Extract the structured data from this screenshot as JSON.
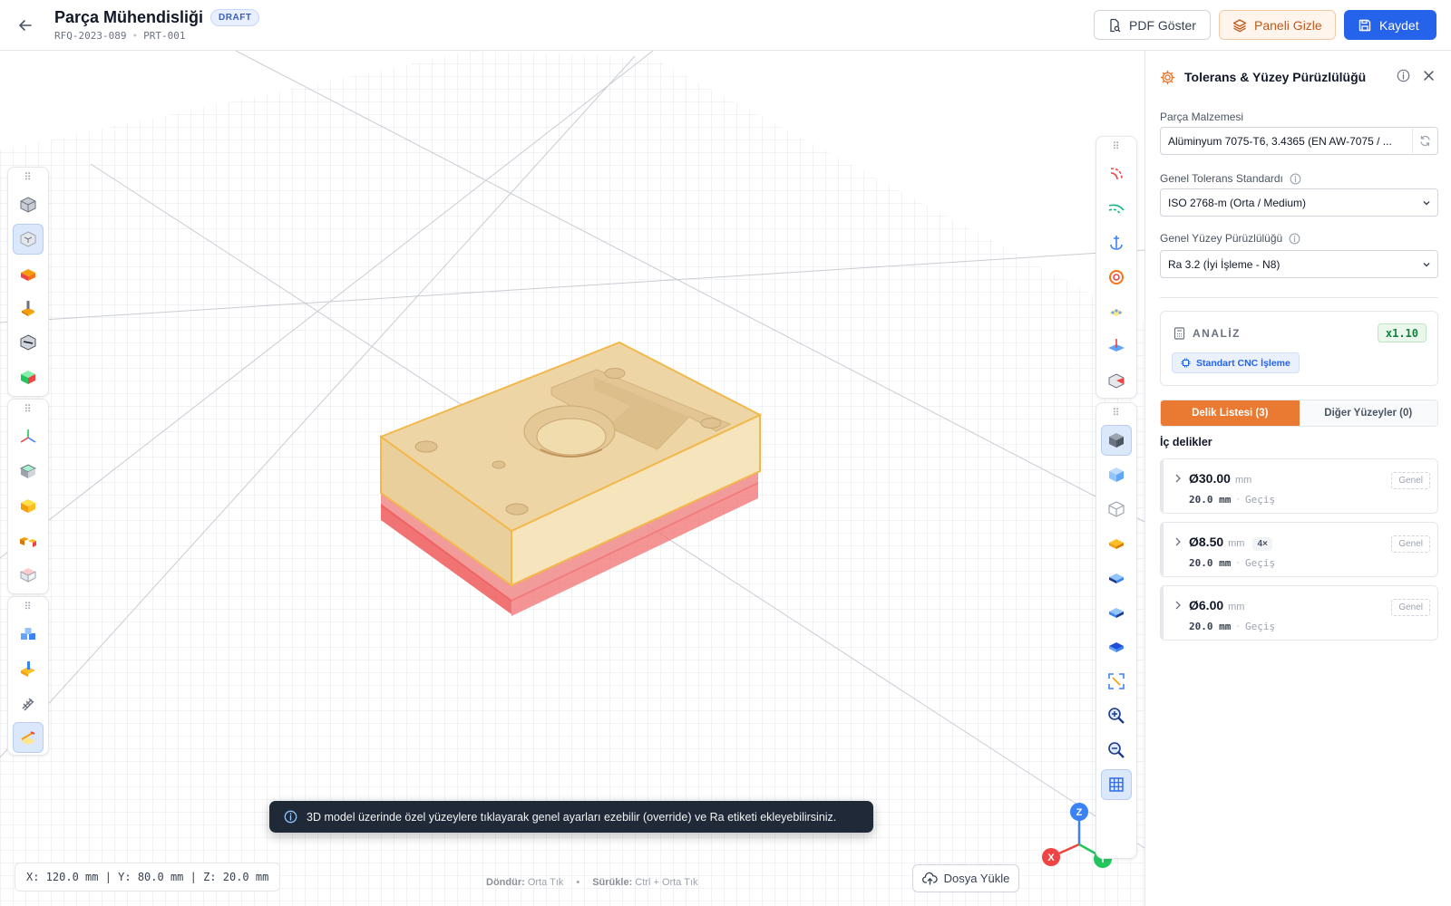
{
  "header": {
    "title": "Parça Mühendisliği",
    "badge": "DRAFT",
    "rfq": "RFQ-2023-089",
    "separator": "•",
    "part_no": "PRT-001",
    "pdf_label": "PDF Göster",
    "panel_label": "Paneli Gizle",
    "save_label": "Kaydet"
  },
  "viewport": {
    "coords": "X: 120.0 mm | Y: 80.0 mm | Z: 20.0 mm",
    "hint_rotate_key": "Döndür:",
    "hint_rotate_val": "Orta Tık",
    "hint_separator": "•",
    "hint_pan_key": "Sürükle:",
    "hint_pan_val": "Ctrl + Orta Tık",
    "upload_label": "Dosya Yükle",
    "toast": "3D model üzerinde özel yüzeylere tıklayarak genel ayarları ezebilir (override) ve Ra etiketi ekleyebilirsiniz.",
    "axis_x": "X",
    "axis_y": "Y",
    "axis_z": "Z"
  },
  "panel": {
    "title": "Tolerans & Yüzey Pürüzlülüğü",
    "material_label": "Parça Malzemesi",
    "material_value": "Alüminyum 7075-T6, 3.4365 (EN AW-7075 / ...",
    "tolerance_label": "Genel Tolerans Standardı",
    "tolerance_value": "ISO 2768-m (Orta / Medium)",
    "roughness_label": "Genel Yüzey Pürüzlülüğü",
    "roughness_value": "Ra 3.2 (İyi İşleme - N8)",
    "analysis_title": "ANALİZ",
    "multiplier": "x1.10",
    "process": "Standart CNC İşleme",
    "tab_holes": "Delik Listesi (3)",
    "tab_other": "Diğer Yüzeyler (0)",
    "section_title": "İç delikler",
    "holes": [
      {
        "dia": "Ø30.00",
        "unit": "mm",
        "count": "",
        "depth": "20.0 mm",
        "sep": "·",
        "type": "Geçiş",
        "tag": "Genel"
      },
      {
        "dia": "Ø8.50",
        "unit": "mm",
        "count": "4×",
        "depth": "20.0 mm",
        "sep": "·",
        "type": "Geçiş",
        "tag": "Genel"
      },
      {
        "dia": "Ø6.00",
        "unit": "mm",
        "count": "",
        "depth": "20.0 mm",
        "sep": "·",
        "type": "Geçiş",
        "tag": "Genel"
      }
    ]
  },
  "colors": {
    "accent": "#2563eb",
    "orange": "#ea7a32",
    "part_body": "#f2dcae",
    "highlight_face": "#ef5b5b",
    "axis_x": "#ef4444",
    "axis_y": "#22c55e",
    "axis_z": "#3b82f6"
  },
  "icons": {
    "left_toolbar_1": [
      "solid-cube-icon",
      "transparent-cube-icon",
      "stock-box-icon",
      "fixture-icon",
      "section-cube-icon",
      "green-cube-icon"
    ],
    "left_toolbar_2": [
      "axis-icon",
      "top-face-icon",
      "yellow-box-icon",
      "split-icon",
      "face-pick-icon"
    ],
    "left_toolbar_3": [
      "blocks-icon",
      "assembly-icon",
      "thread-icon",
      "measure-icon"
    ],
    "right_toolbar_1": [
      "fillet-icon",
      "chamfer-icon",
      "anchor-icon",
      "target-icon",
      "pattern-icon",
      "plane-icon",
      "section-view-icon"
    ],
    "right_toolbar_2": [
      "shaded-view-icon",
      "transparent-view-icon",
      "wireframe-view-icon",
      "top-view-icon",
      "front-view-icon",
      "side-view-icon",
      "iso-view-icon",
      "fit-view-icon",
      "zoom-in-icon",
      "zoom-out-icon",
      "grid-toggle-icon"
    ]
  }
}
